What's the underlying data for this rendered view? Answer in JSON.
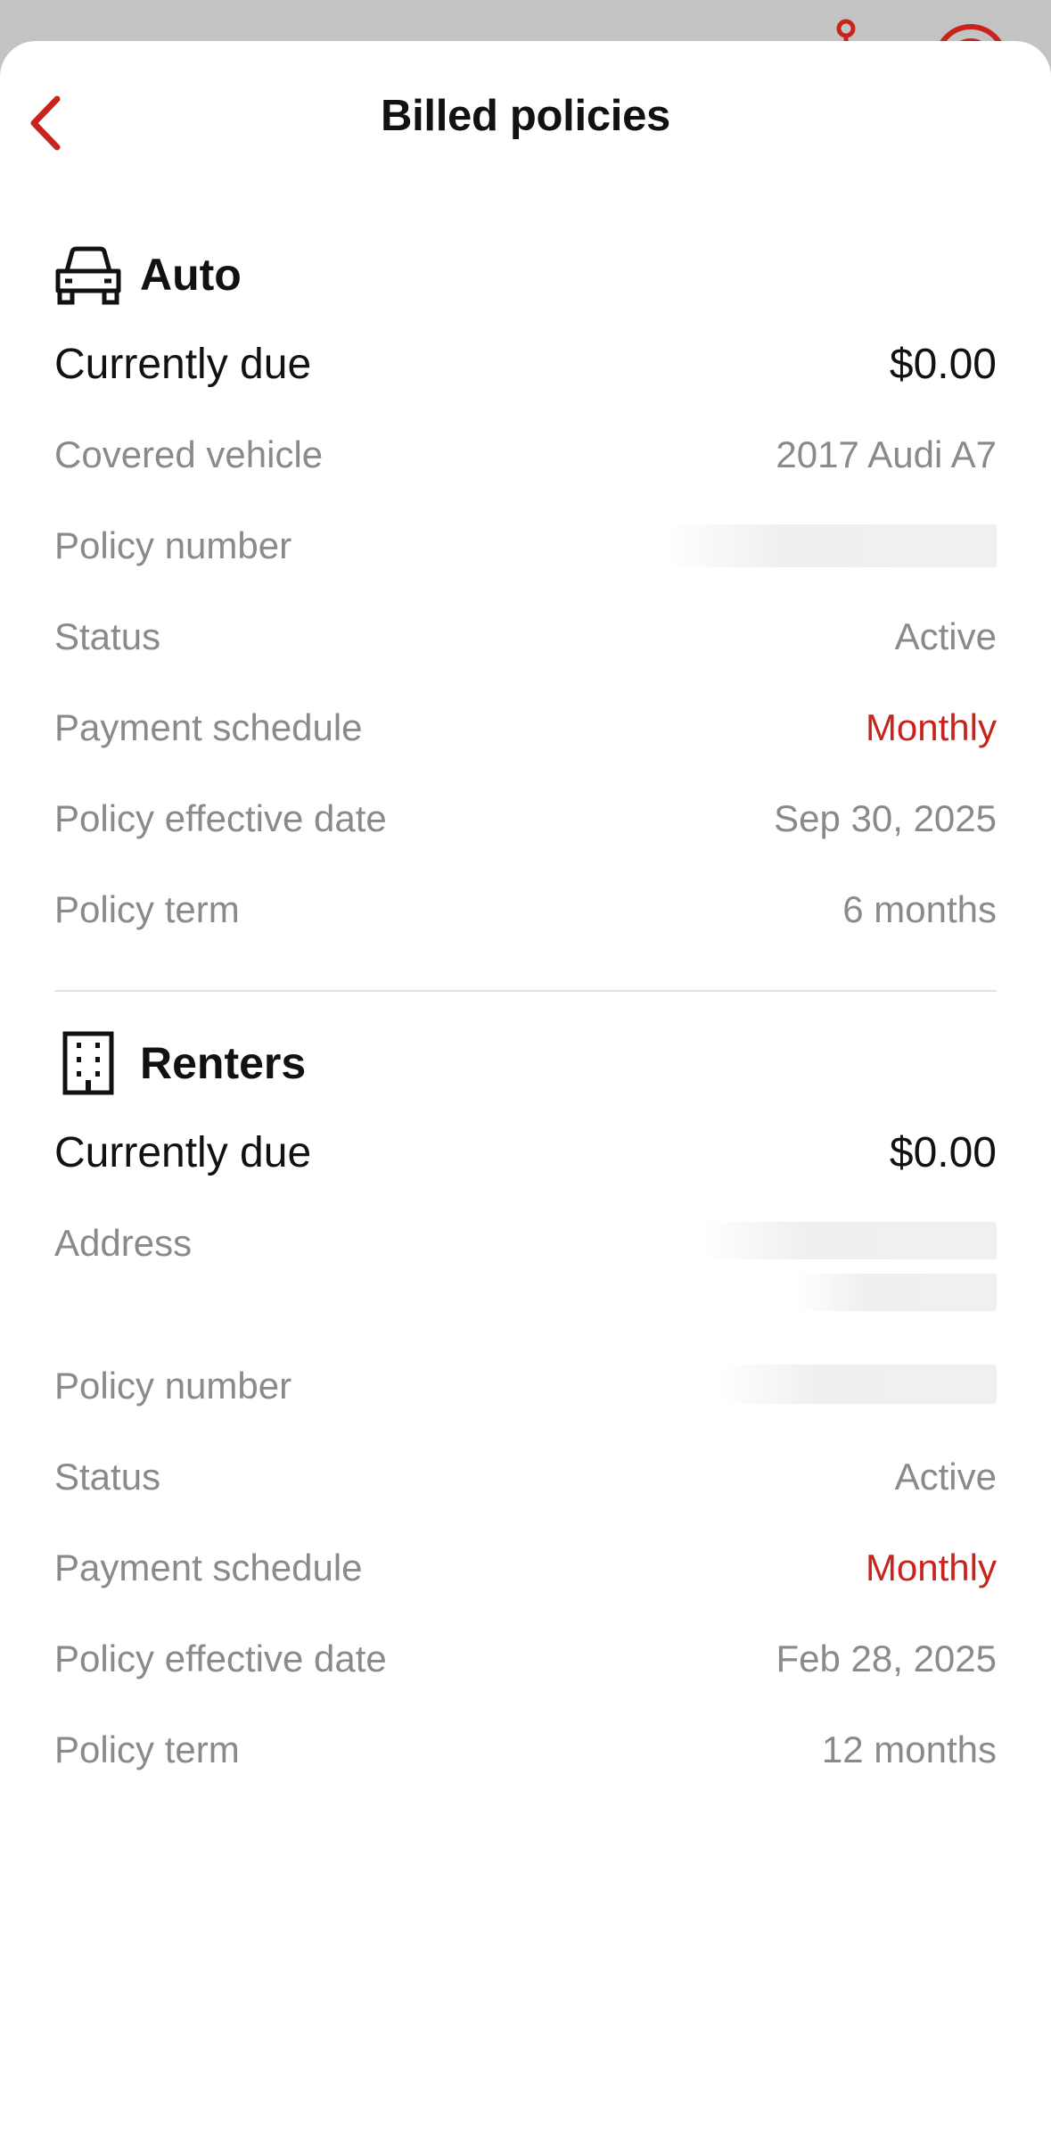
{
  "header": {
    "title": "Billed policies"
  },
  "colors": {
    "accent": "#c8231c",
    "muted_text": "#8a8a8a",
    "primary_text": "#111111"
  },
  "sections": [
    {
      "icon": "car-icon",
      "title": "Auto",
      "due_label": "Currently due",
      "due_amount": "$0.00",
      "rows": [
        {
          "label": "Covered vehicle",
          "value": "2017 Audi A7"
        },
        {
          "label": "Policy number",
          "value": ""
        },
        {
          "label": "Status",
          "value": "Active"
        },
        {
          "label": "Payment schedule",
          "value": "Monthly"
        },
        {
          "label": "Policy effective date",
          "value": "Sep 30, 2025"
        },
        {
          "label": "Policy term",
          "value": "6 months"
        }
      ]
    },
    {
      "icon": "building-icon",
      "title": "Renters",
      "due_label": "Currently due",
      "due_amount": "$0.00",
      "rows": [
        {
          "label": "Address",
          "value": ""
        },
        {
          "label": "Policy number",
          "value": ""
        },
        {
          "label": "Status",
          "value": "Active"
        },
        {
          "label": "Payment schedule",
          "value": "Monthly"
        },
        {
          "label": "Policy effective date",
          "value": "Feb 28, 2025"
        },
        {
          "label": "Policy term",
          "value": "12 months"
        }
      ]
    }
  ]
}
